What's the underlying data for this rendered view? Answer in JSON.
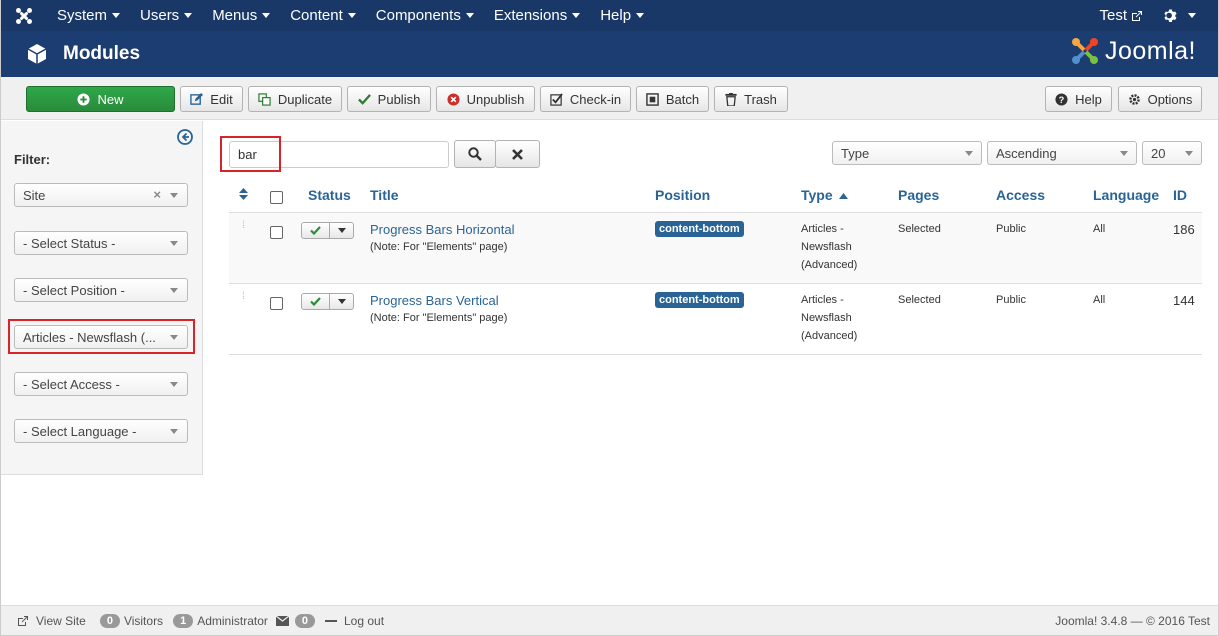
{
  "topnav": {
    "menu": [
      {
        "label": "System"
      },
      {
        "label": "Users"
      },
      {
        "label": "Menus"
      },
      {
        "label": "Content"
      },
      {
        "label": "Components"
      },
      {
        "label": "Extensions"
      },
      {
        "label": "Help"
      }
    ],
    "user": "Test"
  },
  "header": {
    "title": "Modules",
    "brand": "Joomla!"
  },
  "toolbar": {
    "new": "New",
    "edit": "Edit",
    "duplicate": "Duplicate",
    "publish": "Publish",
    "unpublish": "Unpublish",
    "checkin": "Check-in",
    "batch": "Batch",
    "trash": "Trash",
    "help": "Help",
    "options": "Options"
  },
  "sidebar": {
    "filter_label": "Filter:",
    "site": "Site",
    "status": "- Select Status -",
    "position": "- Select Position -",
    "module_type": "Articles - Newsflash (...",
    "access": "- Select Access -",
    "language": "- Select Language -"
  },
  "search": {
    "value": "bar",
    "sort_field": "Type",
    "sort_dir": "Ascending",
    "limit": "20"
  },
  "table": {
    "headers": {
      "status": "Status",
      "title": "Title",
      "position": "Position",
      "type": "Type",
      "pages": "Pages",
      "access": "Access",
      "language": "Language",
      "id": "ID"
    },
    "rows": [
      {
        "title": "Progress Bars Horizontal",
        "note": "(Note: For \"Elements\" page)",
        "position": "content-bottom",
        "type1": "Articles -",
        "type2": "Newsflash",
        "type3": "(Advanced)",
        "pages": "Selected",
        "access": "Public",
        "language": "All",
        "id": "186"
      },
      {
        "title": "Progress Bars Vertical",
        "note": "(Note: For \"Elements\" page)",
        "position": "content-bottom",
        "type1": "Articles -",
        "type2": "Newsflash",
        "type3": "(Advanced)",
        "pages": "Selected",
        "access": "Public",
        "language": "All",
        "id": "144"
      }
    ]
  },
  "footer": {
    "view_site": "View Site",
    "visitors_count": "0",
    "visitors": "Visitors",
    "admin_count": "1",
    "admin": "Administrator",
    "messages_count": "0",
    "logout": "Log out",
    "version": "Joomla! 3.4.8 — © 2016 Test"
  },
  "colors": {
    "topnav": "#1a3867",
    "header": "#1c3d71",
    "link": "#2a6496",
    "new_button": "#2ea84a",
    "highlight": "#d8232a"
  }
}
